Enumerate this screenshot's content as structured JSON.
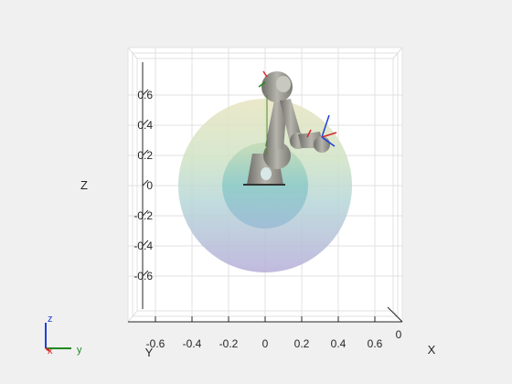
{
  "axes": {
    "xlabel": "X",
    "ylabel": "Y",
    "zlabel": "Z",
    "x_ticks": [
      "-0.6",
      "-0.4",
      "-0.2",
      "0",
      "0.2",
      "0.4",
      "0.6"
    ],
    "y_ticks": [
      "0"
    ],
    "z_ticks": [
      "0.6",
      "0.4",
      "0.2",
      "0",
      "-0.2",
      "-0.4",
      "-0.6"
    ]
  },
  "triad": {
    "x": "x",
    "y": "y",
    "z": "z"
  },
  "colors": {
    "background": "#f0f0f0",
    "axes_face": "#ffffff",
    "grid": "#dcdcdc",
    "triad_x": "#d62728",
    "triad_y": "#1f8a1f",
    "triad_z": "#1f3fd6",
    "robot_metal": "#8a8a86"
  }
}
